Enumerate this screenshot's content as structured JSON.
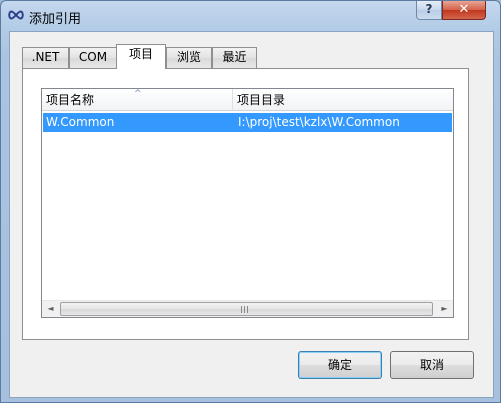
{
  "window": {
    "title": "添加引用",
    "help_label": "?",
    "close_label": "✕"
  },
  "tabs": [
    {
      "label": ".NET"
    },
    {
      "label": "COM"
    },
    {
      "label": "项目",
      "active": true
    },
    {
      "label": "浏览"
    },
    {
      "label": "最近"
    }
  ],
  "list": {
    "columns": [
      "项目名称",
      "项目目录"
    ],
    "rows": [
      {
        "name": "W.Common",
        "directory": "I:\\proj\\test\\kzlx\\W.Common",
        "selected": true
      }
    ],
    "scroll_left": "◄",
    "scroll_right": "►"
  },
  "buttons": {
    "ok_label": "确定",
    "cancel_label": "取消"
  },
  "colors": {
    "selection": "#3399ff",
    "title_gradient": "#b3cbe6"
  }
}
